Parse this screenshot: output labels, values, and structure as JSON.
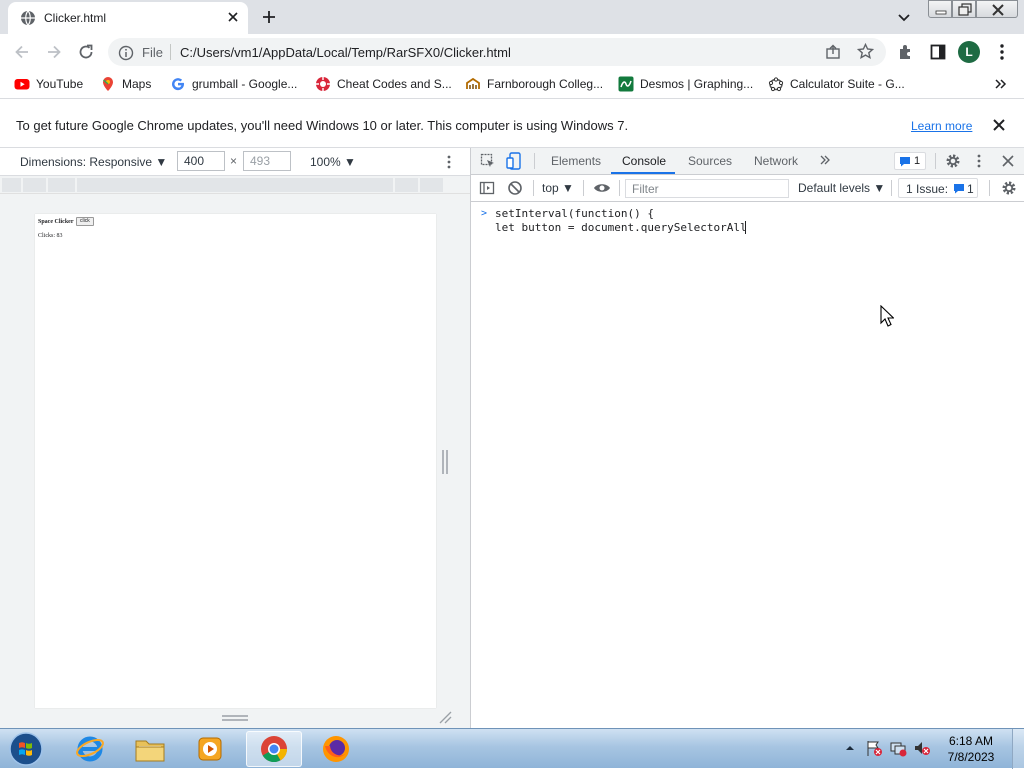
{
  "browser": {
    "tab_title": "Clicker.html",
    "address_scheme": "File",
    "url": "C:/Users/vm1/AppData/Local/Temp/RarSFX0/Clicker.html",
    "profile_initial": "L"
  },
  "bookmarks": [
    {
      "label": "YouTube",
      "icon": "youtube-icon"
    },
    {
      "label": "Maps",
      "icon": "maps-icon"
    },
    {
      "label": "grumball - Google...",
      "icon": "google-icon"
    },
    {
      "label": "Cheat Codes and S...",
      "icon": "cheatcodes-icon"
    },
    {
      "label": "Farnborough Colleg...",
      "icon": "college-icon"
    },
    {
      "label": "Desmos | Graphing...",
      "icon": "desmos-icon"
    },
    {
      "label": "Calculator Suite - G...",
      "icon": "geogebra-icon"
    }
  ],
  "infobar": {
    "message": "To get future Google Chrome updates, you'll need Windows 10 or later. This computer is using Windows 7.",
    "link": "Learn more"
  },
  "device_toolbar": {
    "dimensions_label": "Dimensions: Responsive",
    "width": "400",
    "times": "×",
    "height": "493",
    "zoom": "100%"
  },
  "page_preview": {
    "heading": "Space Clicker",
    "button": "click",
    "clicks_text": "Clicks: 83"
  },
  "devtools": {
    "tabs": [
      "Elements",
      "Console",
      "Sources",
      "Network"
    ],
    "active_tab": "Console",
    "issues_badge": "1",
    "context": "top",
    "filter_placeholder": "Filter",
    "levels": "Default levels",
    "issues_label": "1 Issue:",
    "issues_count": "1",
    "console_lines": [
      "setInterval(function() {",
      "let button = document.querySelectorAll"
    ]
  },
  "taskbar": {
    "time": "6:18 AM",
    "date": "7/8/2023",
    "apps": [
      "internet-explorer-icon",
      "file-explorer-icon",
      "media-player-icon",
      "chrome-icon",
      "firefox-icon"
    ]
  }
}
